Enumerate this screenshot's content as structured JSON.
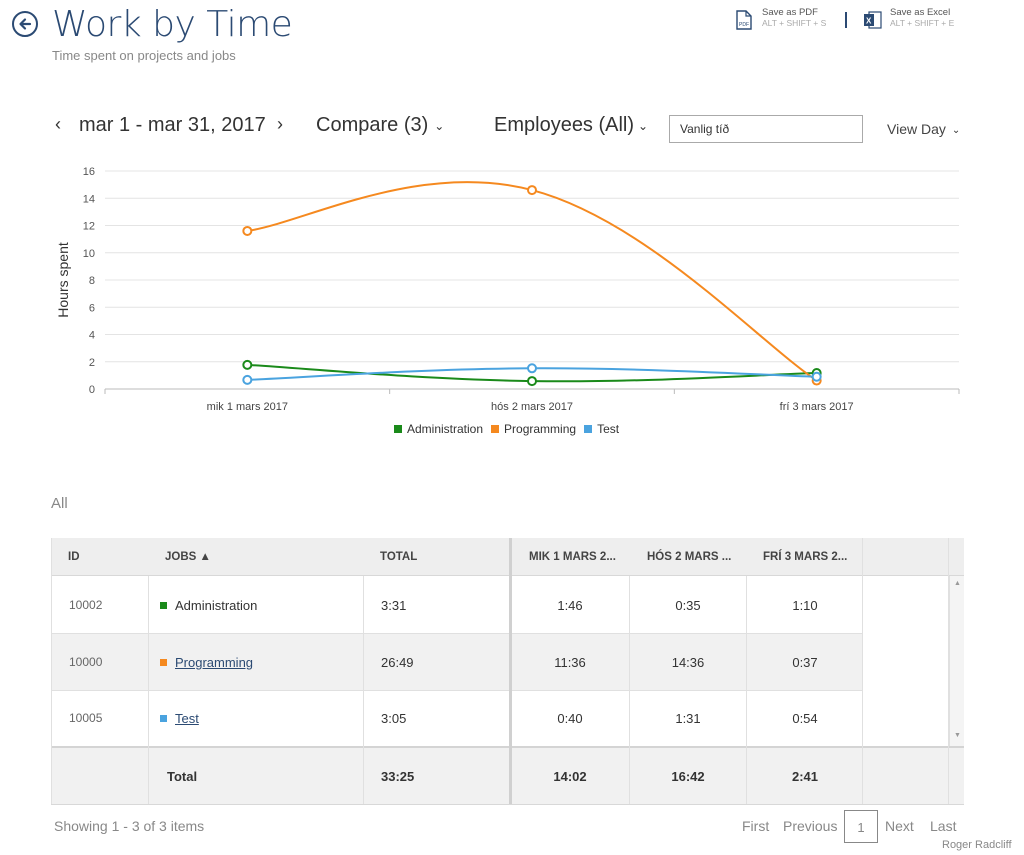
{
  "header": {
    "title": "Work by Time",
    "subtitle": "Time spent on projects and jobs"
  },
  "exports": {
    "pdf_label": "Save as PDF",
    "pdf_shortcut": "ALT + SHIFT + S",
    "excel_label": "Save as Excel",
    "excel_shortcut": "ALT + SHIFT + E"
  },
  "toolbar": {
    "prev": "‹",
    "date_range": "mar 1 - mar 31, 2017",
    "next": "›",
    "compare": "Compare (3)",
    "employees": "Employees (All)",
    "search_value": "Vanlig tíð",
    "view": "View Day"
  },
  "colors": {
    "administration": "#1a8a1a",
    "programming": "#f5891f",
    "test": "#4aa3df",
    "title": "#2b4a73"
  },
  "chart_data": {
    "type": "line",
    "ylabel": "Hours spent",
    "xlabel": "",
    "categories": [
      "mik 1 mars 2017",
      "hós 2 mars 2017",
      "frí 3 mars 2017"
    ],
    "ylim": [
      0,
      16
    ],
    "yticks": [
      0,
      2,
      4,
      6,
      8,
      10,
      12,
      14,
      16
    ],
    "grid": true,
    "legend_position": "bottom",
    "series": [
      {
        "name": "Administration",
        "color": "#1a8a1a",
        "values": [
          1.77,
          0.58,
          1.17
        ]
      },
      {
        "name": "Programming",
        "color": "#f5891f",
        "values": [
          11.6,
          14.6,
          0.62
        ]
      },
      {
        "name": "Test",
        "color": "#4aa3df",
        "values": [
          0.67,
          1.52,
          0.9
        ]
      }
    ]
  },
  "group_label": "All",
  "table": {
    "columns": {
      "id": "ID",
      "jobs": "JOBS ▲",
      "total": "TOTAL",
      "d1": "MIK 1 MARS 2...",
      "d2": "HÓS 2 MARS ...",
      "d3": "FRÍ 3 MARS 2..."
    },
    "rows": [
      {
        "id": "10002",
        "job": "Administration",
        "total": "3:31",
        "d1": "1:46",
        "d2": "0:35",
        "d3": "1:10"
      },
      {
        "id": "10000",
        "job": "Programming",
        "total": "26:49",
        "d1": "11:36",
        "d2": "14:36",
        "d3": "0:37"
      },
      {
        "id": "10005",
        "job": "Test",
        "total": "3:05",
        "d1": "0:40",
        "d2": "1:31",
        "d3": "0:54"
      }
    ],
    "footer": {
      "label": "Total",
      "total": "33:25",
      "d1": "14:02",
      "d2": "16:42",
      "d3": "2:41"
    }
  },
  "pager": {
    "info": "Showing 1 - 3 of 3 items",
    "first": "First",
    "previous": "Previous",
    "current": "1",
    "next": "Next",
    "last": "Last"
  },
  "user": {
    "name": "Roger Radcliff"
  }
}
